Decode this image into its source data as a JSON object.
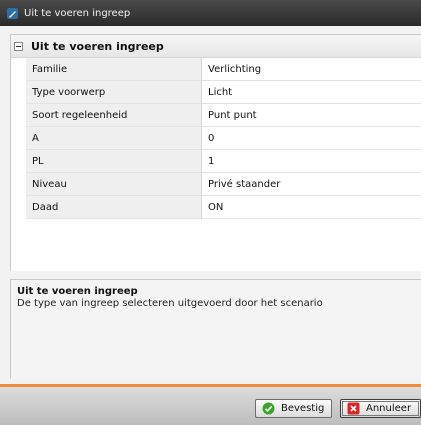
{
  "window": {
    "title": "Uit te voeren ingreep"
  },
  "section": {
    "title": "Uit te voeren ingreep"
  },
  "properties": [
    {
      "key": "Familie",
      "value": "Verlichting"
    },
    {
      "key": "Type voorwerp",
      "value": "Licht"
    },
    {
      "key": "Soort regeleenheid",
      "value": "Punt punt"
    },
    {
      "key": "A",
      "value": "0"
    },
    {
      "key": "PL",
      "value": "1"
    },
    {
      "key": "Niveau",
      "value": "Privé staander"
    },
    {
      "key": "Daad",
      "value": "ON"
    }
  ],
  "description": {
    "title": "Uit te voeren ingreep",
    "text": "De type van ingreep selecteren uitgevoerd door het scenario"
  },
  "buttons": {
    "confirm": "Bevestig",
    "cancel": "Annuleer"
  },
  "icons": {
    "title": "pencil-icon",
    "confirm": "check-icon",
    "cancel": "close-icon"
  },
  "colors": {
    "accent": "#f08a3c",
    "confirm_icon": "#3aa32a",
    "cancel_icon": "#d6282a"
  }
}
